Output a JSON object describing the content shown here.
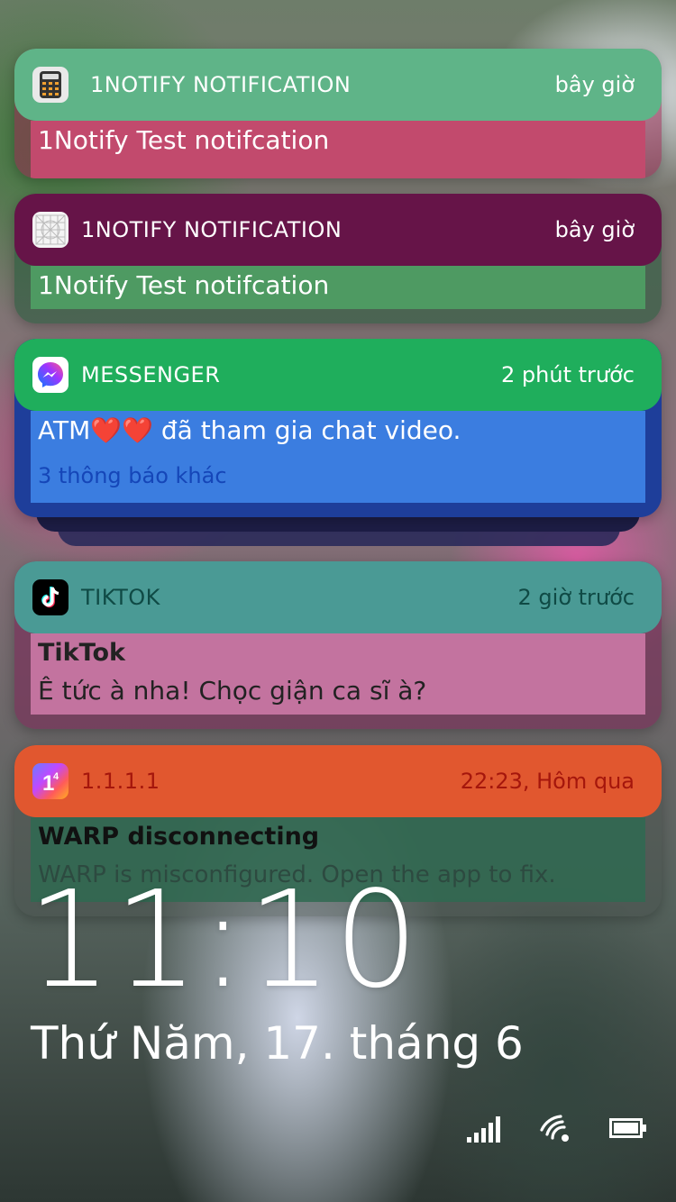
{
  "colors": {
    "notif1_head": "#5fb488",
    "notif1_body": "#c24a6d",
    "notif2_head": "#661448",
    "notif2_body": "#4e9a62",
    "messenger_head": "#1fae5c",
    "messenger_body": "#3b7de0",
    "tiktok_head": "#4a9a95",
    "tiktok_body": "#c3739f",
    "warp_head": "#e1572f",
    "warp_body": "#2f6a51"
  },
  "notifications": [
    {
      "app": "1NOTIFY NOTIFICATION",
      "time": "bây giờ",
      "text": "1Notify Test notifcation",
      "icon": "calculator-icon"
    },
    {
      "app": "1NOTIFY NOTIFICATION",
      "time": "bây giờ",
      "text": "1Notify Test notifcation",
      "icon": "grid-icon"
    },
    {
      "app": "MESSENGER",
      "time": "2 phút trước",
      "text": "ATM❤️❤️ đã tham gia chat video.",
      "more": "3 thông báo khác",
      "icon": "messenger-icon"
    },
    {
      "app": "TIKTOK",
      "time": "2 giờ trước",
      "title": "TikTok",
      "text": "Ê tức à nha! Chọc giận ca sĩ à?",
      "icon": "tiktok-icon"
    },
    {
      "app": "1.1.1.1",
      "time": "22:23, Hôm qua",
      "title": "WARP disconnecting",
      "text": "WARP is misconfigured. Open the app to fix.",
      "icon": "cloudflare-1111-icon"
    }
  ],
  "lockscreen": {
    "time": "11:10",
    "date": "Thứ Năm, 17. tháng 6"
  },
  "status_icons": [
    "signal-bars-icon",
    "wifi-icon",
    "battery-icon"
  ]
}
